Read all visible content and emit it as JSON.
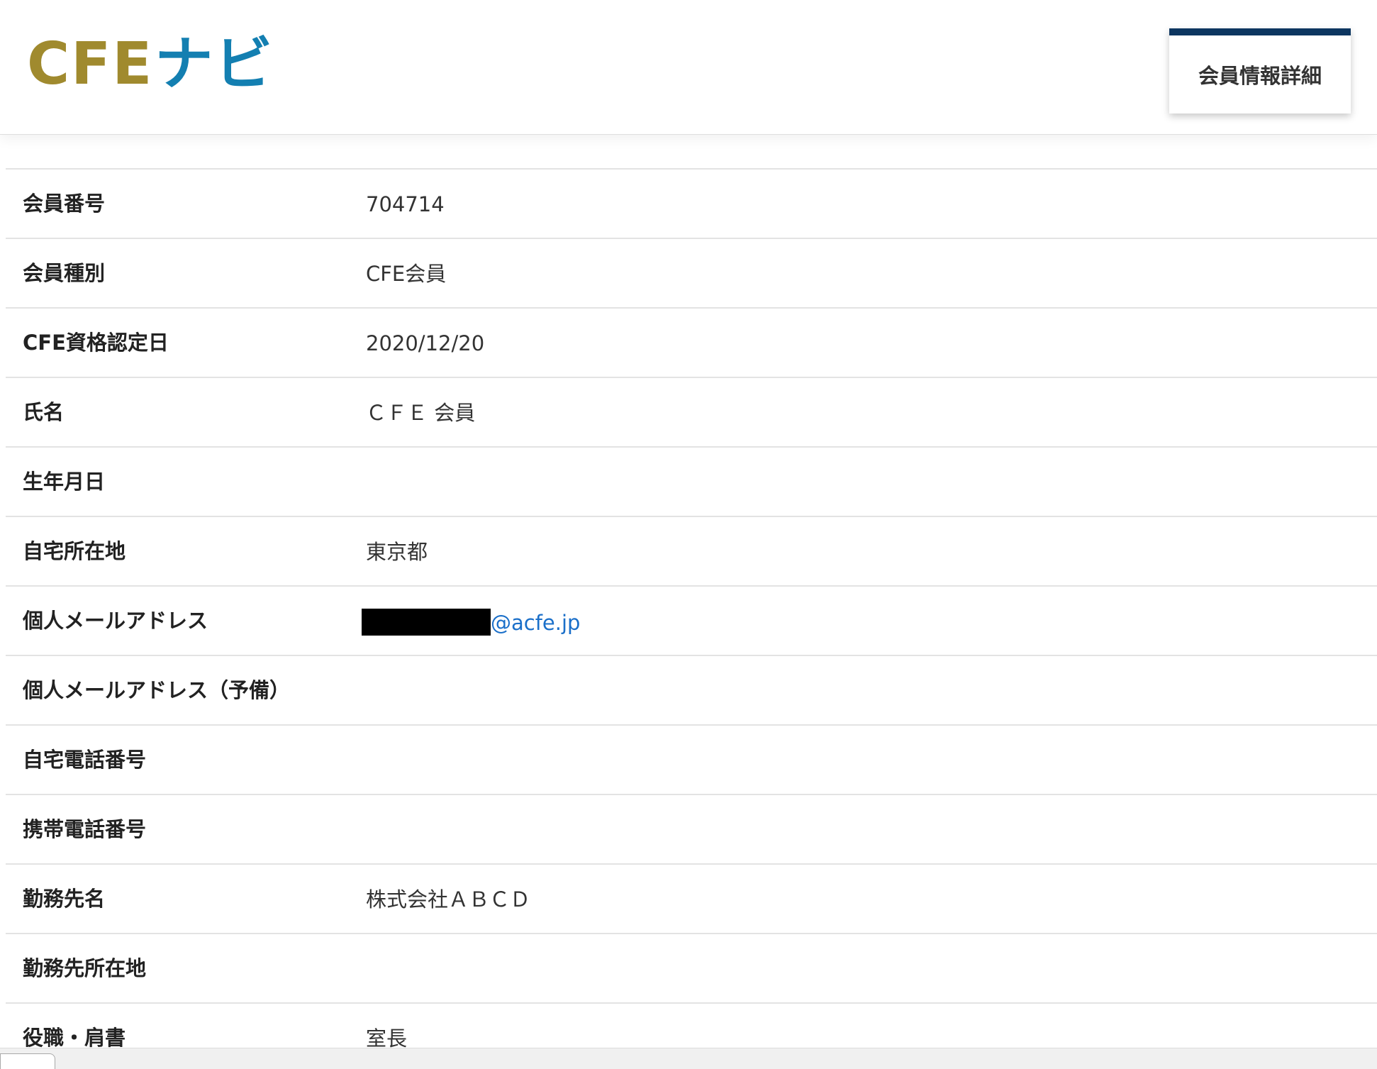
{
  "header": {
    "logo": {
      "part_a": "CFE",
      "part_b": "ナビ",
      "color_a": "#a08a2e",
      "color_b": "#137fb1"
    },
    "active_tab_label": "会員情報詳細",
    "tab_accent_color": "#0d3660"
  },
  "details": {
    "rows": [
      {
        "label": "会員番号",
        "value": "704714"
      },
      {
        "label": "会員種別",
        "value": "CFE会員"
      },
      {
        "label": "CFE資格認定日",
        "value": "2020/12/20"
      },
      {
        "label": "氏名",
        "value": "ＣＦＥ 会員"
      },
      {
        "label": "生年月日",
        "value": ""
      },
      {
        "label": "自宅所在地",
        "value": "東京都"
      },
      {
        "label": "個人メールアドレス",
        "value": "@acfe.jp"
      },
      {
        "label": "個人メールアドレス（予備）",
        "value": ""
      },
      {
        "label": "自宅電話番号",
        "value": ""
      },
      {
        "label": "携帯電話番号",
        "value": ""
      },
      {
        "label": "勤務先名",
        "value": "株式会社ＡＢＣＤ"
      },
      {
        "label": "勤務先所在地",
        "value": ""
      },
      {
        "label": "役職・肩書",
        "value": "室長"
      }
    ]
  },
  "colors": {
    "link": "#1a6fc9",
    "divider": "#e3e3e3"
  }
}
